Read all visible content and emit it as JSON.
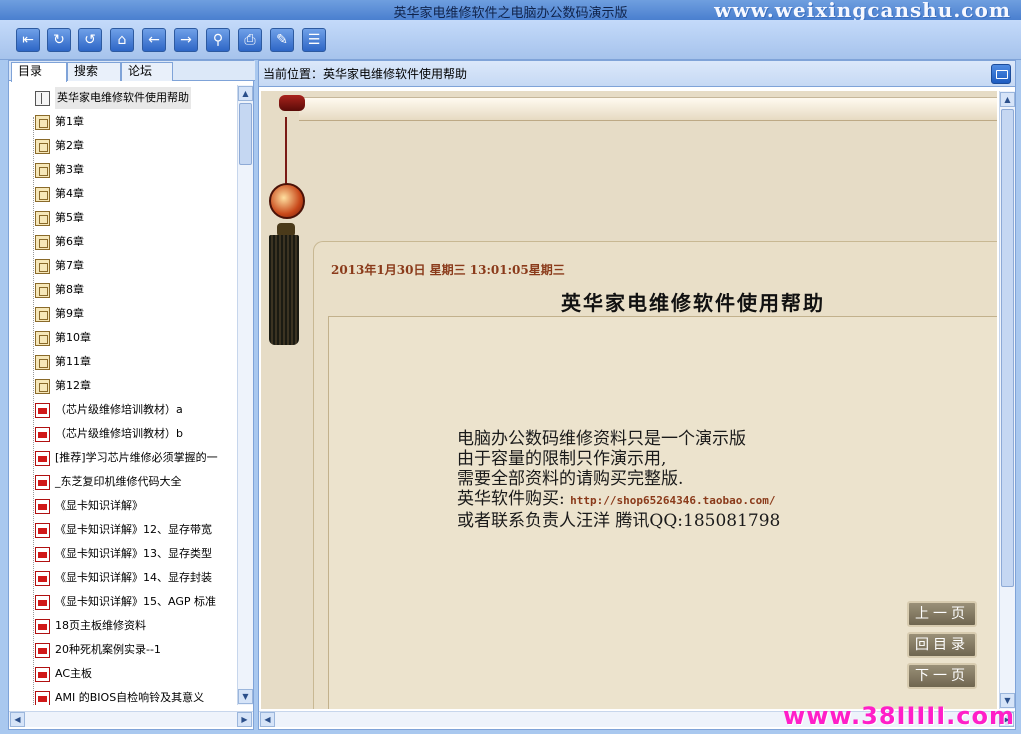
{
  "window": {
    "title": "英华家电维修软件之电脑办公数码演示版",
    "watermark_top": "www.weixingcanshu.com"
  },
  "toolbar": {
    "buttons": [
      {
        "name": "hide-icon",
        "glyph": "⇤"
      },
      {
        "name": "refresh-icon",
        "glyph": "↻"
      },
      {
        "name": "reload-icon",
        "glyph": "↺"
      },
      {
        "name": "home-icon",
        "glyph": "⌂"
      },
      {
        "name": "back-icon",
        "glyph": "←"
      },
      {
        "name": "forward-icon",
        "glyph": "→"
      },
      {
        "name": "search-icon",
        "glyph": "⚲"
      },
      {
        "name": "print-icon",
        "glyph": "⎙"
      },
      {
        "name": "favorite-icon",
        "glyph": "✎"
      },
      {
        "name": "options-icon",
        "glyph": "☰"
      }
    ]
  },
  "left_panel": {
    "tabs": [
      "目录",
      "搜索",
      "论坛"
    ],
    "tree": [
      {
        "label": "英华家电维修软件使用帮助",
        "icon": "book"
      },
      {
        "label": "第1章",
        "icon": "page"
      },
      {
        "label": "第2章",
        "icon": "page"
      },
      {
        "label": "第3章",
        "icon": "page"
      },
      {
        "label": "第4章",
        "icon": "page"
      },
      {
        "label": "第5章",
        "icon": "page"
      },
      {
        "label": "第6章",
        "icon": "page"
      },
      {
        "label": "第7章",
        "icon": "page"
      },
      {
        "label": "第8章",
        "icon": "page"
      },
      {
        "label": "第9章",
        "icon": "page"
      },
      {
        "label": "第10章",
        "icon": "page"
      },
      {
        "label": "第11章",
        "icon": "page"
      },
      {
        "label": "第12章",
        "icon": "page"
      },
      {
        "label": "（芯片级维修培训教材）a",
        "icon": "pdf"
      },
      {
        "label": "（芯片级维修培训教材）b",
        "icon": "pdf"
      },
      {
        "label": "[推荐]学习芯片维修必须掌握的一",
        "icon": "pdf"
      },
      {
        "label": "_东芝复印机维修代码大全",
        "icon": "pdf"
      },
      {
        "label": "《显卡知识详解》",
        "icon": "pdf"
      },
      {
        "label": "《显卡知识详解》12、显存带宽",
        "icon": "pdf"
      },
      {
        "label": "《显卡知识详解》13、显存类型",
        "icon": "pdf"
      },
      {
        "label": "《显卡知识详解》14、显存封装",
        "icon": "pdf"
      },
      {
        "label": "《显卡知识详解》15、AGP 标准",
        "icon": "pdf"
      },
      {
        "label": "18页主板维修资料",
        "icon": "pdf"
      },
      {
        "label": "20种死机案例实录--1",
        "icon": "pdf"
      },
      {
        "label": "AC主板",
        "icon": "pdf"
      },
      {
        "label": "AMI 的BIOS自检响铃及其意义",
        "icon": "pdf"
      }
    ]
  },
  "right_panel": {
    "location_label": "当前位置：",
    "location_value": "英华家电维修软件使用帮助",
    "date": "2013年1月30日 星期三 13:01:05星期三",
    "heading": "英华家电维修软件使用帮助",
    "body_lines": [
      "电脑办公数码维修资料只是一个演示版",
      "由于容量的限制只作演示用,",
      "需要全部资料的请购买完整版."
    ],
    "buy_label": "英华软件购买:",
    "buy_link": "http://shop65264346.taobao.com/",
    "contact": "或者联系负责人汪洋 腾讯QQ:185081798",
    "nav": {
      "prev": "上一页",
      "toc": "回目录",
      "next": "下一页"
    }
  },
  "footer_watermark": "www.38IIIII.com"
}
